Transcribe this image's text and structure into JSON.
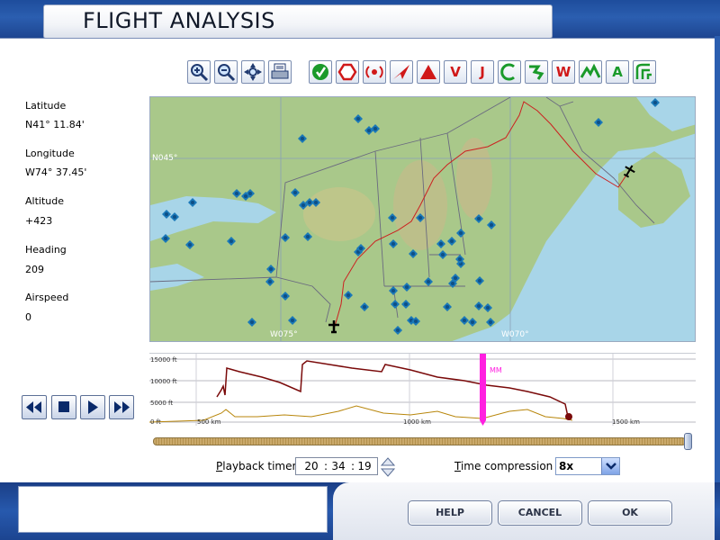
{
  "window": {
    "title": "FLIGHT ANALYSIS"
  },
  "info": {
    "latitude_label": "Latitude",
    "latitude_value": "N41° 11.84'",
    "longitude_label": "Longitude",
    "longitude_value": "W74° 37.45'",
    "altitude_label": "Altitude",
    "altitude_value": "+423",
    "heading_label": "Heading",
    "heading_value": "209",
    "airspeed_label": "Airspeed",
    "airspeed_value": "0"
  },
  "toolbar": {
    "view_tools": [
      "zoom-in-icon",
      "zoom-out-icon",
      "pan-icon",
      "print-icon"
    ],
    "filter_tools": [
      {
        "icon": "check-icon",
        "text": "",
        "color": "#1a9a2a"
      },
      {
        "icon": "hexagon-icon",
        "text": "",
        "color": "#d01818"
      },
      {
        "icon": "radio-icon",
        "text": "",
        "color": "#d01818"
      },
      {
        "icon": "plane-arrow-icon",
        "text": "",
        "color": "#d01818"
      },
      {
        "icon": "triangle-icon",
        "text": "",
        "color": "#d01818"
      },
      {
        "icon": "v-icon",
        "text": "V",
        "color": "#d01818"
      },
      {
        "icon": "j-icon",
        "text": "J",
        "color": "#d01818"
      },
      {
        "icon": "c-route-icon",
        "text": "",
        "color": "#1a9a2a"
      },
      {
        "icon": "track-icon",
        "text": "",
        "color": "#1a9a2a"
      },
      {
        "icon": "w-icon",
        "text": "W",
        "color": "#d01818"
      },
      {
        "icon": "terrain-icon",
        "text": "",
        "color": "#1a9a2a"
      },
      {
        "icon": "altitude-a-icon",
        "text": "A",
        "color": "#1a9a2a"
      },
      {
        "icon": "airway-icon",
        "text": "",
        "color": "#1a9a2a"
      }
    ]
  },
  "map": {
    "lat_labels": [
      "N045°"
    ],
    "lon_labels": [
      "W075°",
      "W070°"
    ]
  },
  "profile": {
    "y_labels": [
      "15000 ft",
      "10000 ft",
      "5000 ft",
      "0 ft"
    ],
    "x_labels": [
      "500 km",
      "1000 km",
      "1500 km"
    ],
    "marker_label": "MM"
  },
  "playback": {
    "timer_label": "Playback timer",
    "timer_hour": "20",
    "timer_minute": "34",
    "timer_second": "19",
    "compression_label": "Time compression",
    "compression_value": "8x",
    "scrub_position": 1.0
  },
  "buttons": {
    "help": "HELP",
    "cancel": "CANCEL",
    "ok": "OK"
  },
  "colors": {
    "frame": "#2b5eb0",
    "flight_path": "#cc2020",
    "profile_flight": "#7a0a0a",
    "profile_terrain": "#b8860b",
    "marker": "#ff20e0"
  }
}
